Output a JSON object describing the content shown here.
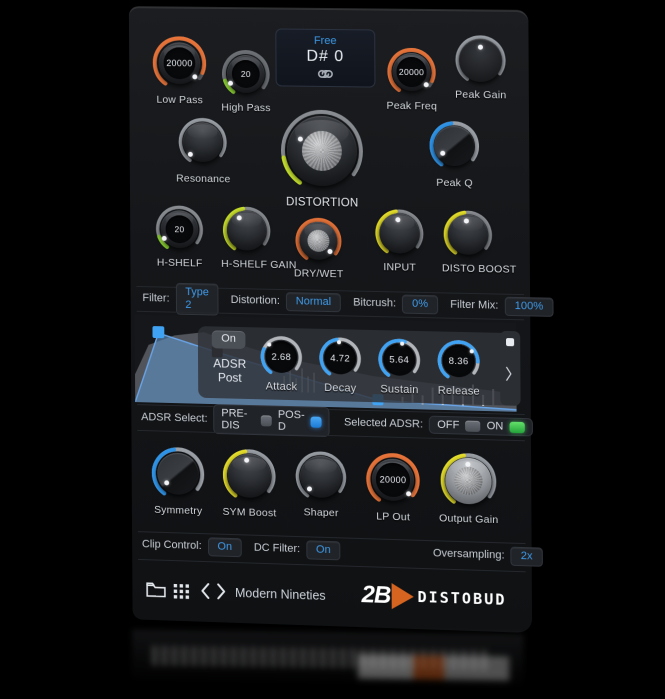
{
  "plugin": {
    "name": "DISTOBUD",
    "brand": "2B",
    "preset": "Modern Nineties"
  },
  "display": {
    "mode": "Free",
    "note": "D# 0",
    "link_icon": "link-icon"
  },
  "knobs_top": [
    {
      "label": "Low Pass",
      "value": "20000",
      "arc": "#e8743a"
    },
    {
      "label": "High Pass",
      "value": "20",
      "arc": "#8cd531"
    },
    {
      "label": "Peak Freq",
      "value": "20000",
      "arc": "#e8743a"
    },
    {
      "label": "Peak Gain",
      "value": "",
      "arc": "#9ba0a7"
    }
  ],
  "knobs_mid": [
    {
      "label": "Resonance",
      "value": "",
      "arc": "#9ba0a7"
    },
    {
      "label": "DISTORTION",
      "value": "",
      "arc": "#c8e22e"
    },
    {
      "label": "Peak Q",
      "value": "",
      "arc": "#2f94e8"
    }
  ],
  "knobs_row3": [
    {
      "label": "H-SHELF",
      "value": "20",
      "arc": "#8cd531"
    },
    {
      "label": "H-SHELF GAIN",
      "value": "",
      "arc": "#cbe22c"
    },
    {
      "label": "DRY/WET",
      "value": "",
      "arc": "#e8743a"
    },
    {
      "label": "INPUT",
      "value": "",
      "arc": "#e8e12a"
    },
    {
      "label": "DISTO BOOST",
      "value": "",
      "arc": "#e8e12a"
    }
  ],
  "param_bar": [
    {
      "label": "Filter:",
      "value": "Type 2"
    },
    {
      "label": "Distortion:",
      "value": "Normal"
    },
    {
      "label": "Bitcrush:",
      "value": "0%"
    },
    {
      "label": "Filter Mix:",
      "value": "100%"
    }
  ],
  "adsr": {
    "on_label": "On",
    "title_line1": "ADSR",
    "title_line2": "Post",
    "knobs": [
      {
        "label": "Attack",
        "value": "2.68"
      },
      {
        "label": "Decay",
        "value": "4.72"
      },
      {
        "label": "Sustain",
        "value": "5.64"
      },
      {
        "label": "Release",
        "value": "8.36"
      }
    ],
    "expand_icon": "chevron-right-icon"
  },
  "adsr_select": {
    "label": "ADSR Select:",
    "option_a": "PRE-DIS",
    "option_b": "POS-D",
    "selected_label": "Selected ADSR:",
    "off_label": "OFF",
    "on_label": "ON"
  },
  "knobs_bottom": [
    {
      "label": "Symmetry",
      "value": "",
      "arc": "#2f94e8"
    },
    {
      "label": "SYM Boost",
      "value": "",
      "arc": "#e8e12a"
    },
    {
      "label": "Shaper",
      "value": "",
      "arc": "#9ba0a7"
    },
    {
      "label": "LP Out",
      "value": "20000",
      "arc": "#e8743a"
    },
    {
      "label": "Output Gain",
      "value": "",
      "arc": "#e8e12a"
    }
  ],
  "bottom_bar": {
    "clip_label": "Clip Control:",
    "clip_value": "On",
    "dc_label": "DC Filter:",
    "dc_value": "On",
    "oversampling_label": "Oversampling:",
    "oversampling_value": "2x"
  },
  "footer": {
    "folder_icon": "folder-icon",
    "grid_icon": "grid-icon",
    "prev_icon": "chevron-left-icon",
    "next_icon": "chevron-right-icon"
  },
  "colors": {
    "accent_blue": "#3f9bea",
    "accent_orange": "#d4641f",
    "accent_green": "#46d75f",
    "accent_yellow": "#e8e12a"
  }
}
